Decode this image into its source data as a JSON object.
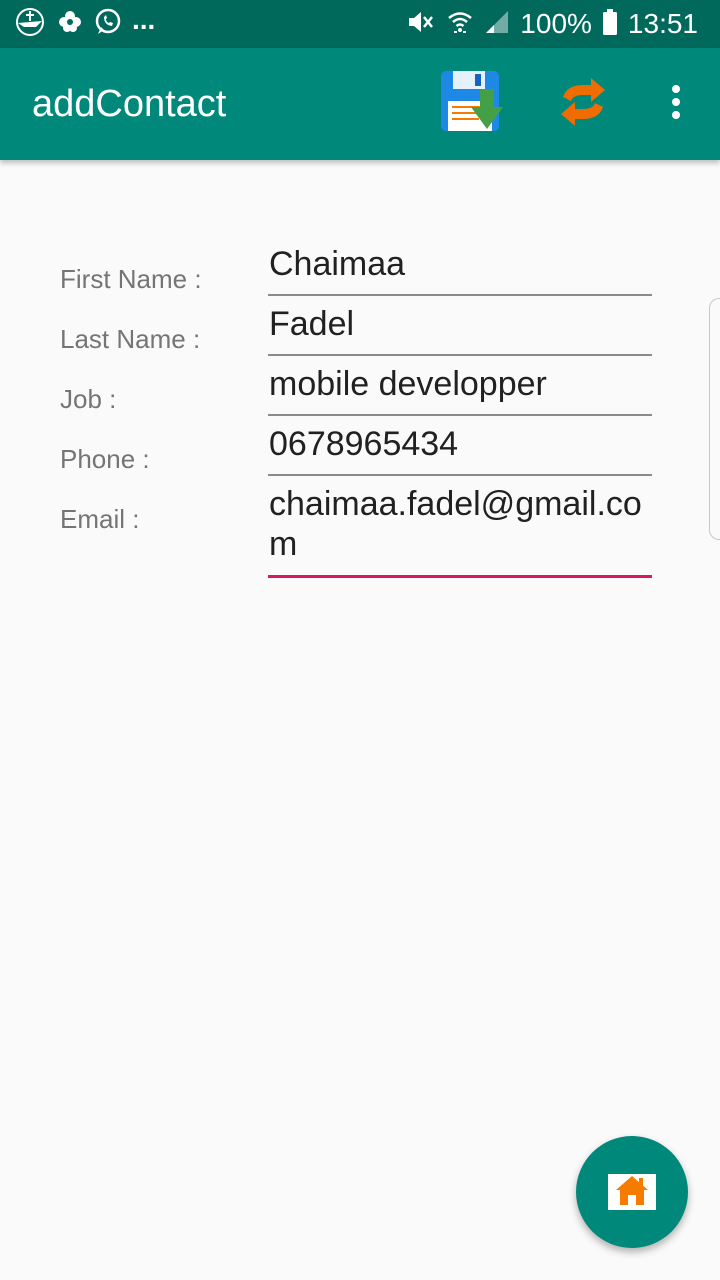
{
  "status_bar": {
    "more_notifications": "...",
    "battery_percent": "100%",
    "time": "13:51",
    "icons": [
      "boat-icon",
      "flower-icon",
      "whatsapp-icon",
      "mute-icon",
      "wifi-icon",
      "signal-icon",
      "battery-icon"
    ]
  },
  "app_bar": {
    "title": "addContact",
    "background_color": "#00897b",
    "actions": [
      "save-icon",
      "sync-icon",
      "more-vert-icon"
    ]
  },
  "form": {
    "fields": [
      {
        "label": "First Name :",
        "value": "Chaimaa"
      },
      {
        "label": "Last Name :",
        "value": "Fadel"
      },
      {
        "label": "Job :",
        "value": "mobile developper"
      },
      {
        "label": "Phone :",
        "value": "0678965434"
      },
      {
        "label": "Email :",
        "value": "chaimaa.fadel@gmail.com",
        "focused": true
      }
    ],
    "focus_color": "#d81b60"
  },
  "fab": {
    "icon": "home-icon",
    "color": "#00897b"
  }
}
